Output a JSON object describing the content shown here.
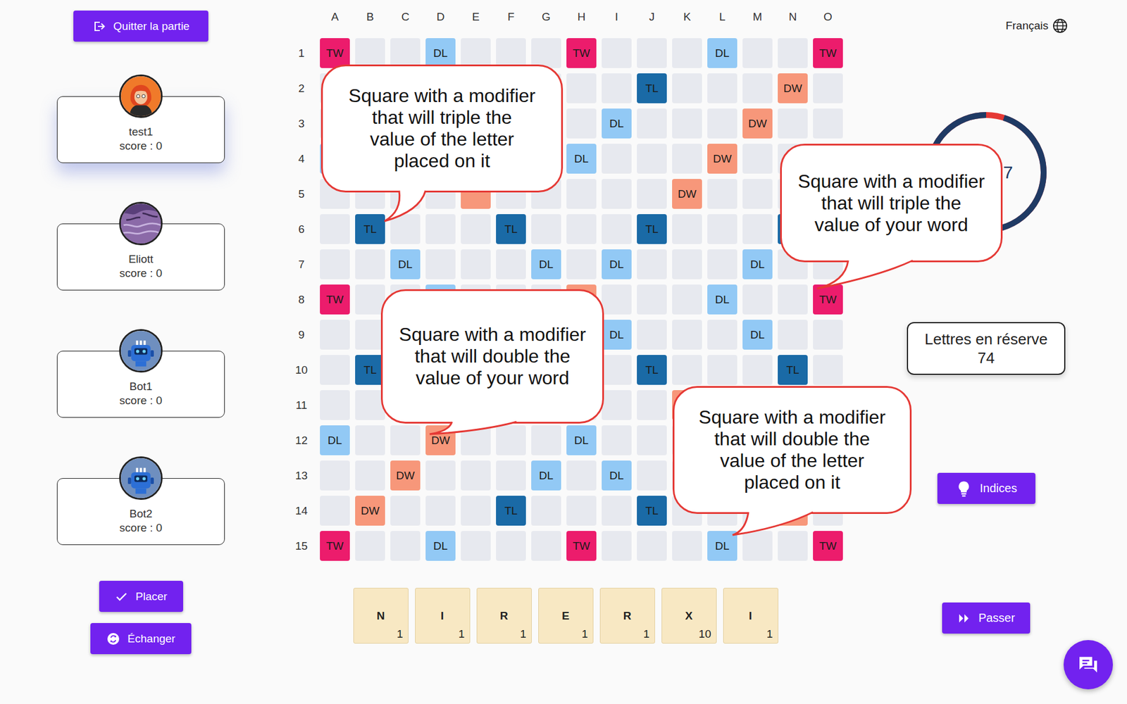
{
  "header": {
    "quit": "Quitter la partie",
    "language": "Français"
  },
  "players": [
    {
      "name": "test1",
      "score": "score : 0",
      "selected": true,
      "kind": "human"
    },
    {
      "name": "Eliott",
      "score": "score : 0",
      "selected": false,
      "kind": "monster"
    },
    {
      "name": "Bot1",
      "score": "score : 0",
      "selected": false,
      "kind": "bot"
    },
    {
      "name": "Bot2",
      "score": "score : 0",
      "selected": false,
      "kind": "bot"
    }
  ],
  "actions": {
    "place": "Placer",
    "exchange": "Échanger",
    "hints": "Indices",
    "pass": "Passer"
  },
  "timer": {
    "text": "7",
    "level": 0.95
  },
  "reserve": {
    "title": "Lettres en réserve",
    "count": "74"
  },
  "board": {
    "columns": [
      "A",
      "B",
      "C",
      "D",
      "E",
      "F",
      "G",
      "H",
      "I",
      "J",
      "K",
      "L",
      "M",
      "N",
      "O"
    ],
    "rows": [
      {
        "label": "1",
        "cells": [
          {
            "mod": "TW",
            "label": "TW"
          },
          {
            "mod": "none"
          },
          {
            "mod": "none"
          },
          {
            "mod": "DL",
            "label": "DL"
          },
          {
            "mod": "none"
          },
          {
            "mod": "none"
          },
          {
            "mod": "none"
          },
          {
            "mod": "TW",
            "label": "TW"
          },
          {
            "mod": "none"
          },
          {
            "mod": "none"
          },
          {
            "mod": "none"
          },
          {
            "mod": "DL",
            "label": "DL"
          },
          {
            "mod": "none"
          },
          {
            "mod": "none"
          },
          {
            "mod": "TW",
            "label": "TW"
          }
        ]
      },
      {
        "label": "2",
        "cells": [
          {
            "mod": "none"
          },
          {
            "mod": "DW"
          },
          {
            "mod": "none"
          },
          {
            "mod": "none"
          },
          {
            "mod": "none"
          },
          {
            "mod": "TL"
          },
          {
            "mod": "none"
          },
          {
            "mod": "none"
          },
          {
            "mod": "none"
          },
          {
            "mod": "TL",
            "label": "TL"
          },
          {
            "mod": "none"
          },
          {
            "mod": "none"
          },
          {
            "mod": "none"
          },
          {
            "mod": "DW",
            "label": "DW"
          },
          {
            "mod": "none"
          }
        ]
      },
      {
        "label": "3",
        "cells": [
          {
            "mod": "none"
          },
          {
            "mod": "none"
          },
          {
            "mod": "DW"
          },
          {
            "mod": "none"
          },
          {
            "mod": "none"
          },
          {
            "mod": "none"
          },
          {
            "mod": "DL"
          },
          {
            "mod": "none"
          },
          {
            "mod": "DL",
            "label": "DL"
          },
          {
            "mod": "none"
          },
          {
            "mod": "none"
          },
          {
            "mod": "none"
          },
          {
            "mod": "DW",
            "label": "DW"
          },
          {
            "mod": "none"
          },
          {
            "mod": "none"
          }
        ]
      },
      {
        "label": "4",
        "cells": [
          {
            "mod": "DL"
          },
          {
            "mod": "none"
          },
          {
            "mod": "none"
          },
          {
            "mod": "DW"
          },
          {
            "mod": "none"
          },
          {
            "mod": "none"
          },
          {
            "mod": "none"
          },
          {
            "mod": "DL",
            "label": "DL"
          },
          {
            "mod": "none"
          },
          {
            "mod": "none"
          },
          {
            "mod": "none"
          },
          {
            "mod": "DW",
            "label": "DW"
          },
          {
            "mod": "none"
          },
          {
            "mod": "none"
          },
          {
            "mod": "DL"
          }
        ]
      },
      {
        "label": "5",
        "cells": [
          {
            "mod": "none"
          },
          {
            "mod": "none"
          },
          {
            "mod": "none"
          },
          {
            "mod": "none"
          },
          {
            "mod": "DW"
          },
          {
            "mod": "none"
          },
          {
            "mod": "none"
          },
          {
            "mod": "none"
          },
          {
            "mod": "none"
          },
          {
            "mod": "none"
          },
          {
            "mod": "DW",
            "label": "DW"
          },
          {
            "mod": "none"
          },
          {
            "mod": "none"
          },
          {
            "mod": "none"
          },
          {
            "mod": "none"
          }
        ]
      },
      {
        "label": "6",
        "cells": [
          {
            "mod": "none"
          },
          {
            "mod": "TL",
            "label": "TL"
          },
          {
            "mod": "none"
          },
          {
            "mod": "none"
          },
          {
            "mod": "none"
          },
          {
            "mod": "TL",
            "label": "TL"
          },
          {
            "mod": "none"
          },
          {
            "mod": "none"
          },
          {
            "mod": "none"
          },
          {
            "mod": "TL",
            "label": "TL"
          },
          {
            "mod": "none"
          },
          {
            "mod": "none"
          },
          {
            "mod": "none"
          },
          {
            "mod": "TL"
          },
          {
            "mod": "none"
          }
        ]
      },
      {
        "label": "7",
        "cells": [
          {
            "mod": "none"
          },
          {
            "mod": "none"
          },
          {
            "mod": "DL",
            "label": "DL"
          },
          {
            "mod": "none"
          },
          {
            "mod": "none"
          },
          {
            "mod": "none"
          },
          {
            "mod": "DL",
            "label": "DL"
          },
          {
            "mod": "none"
          },
          {
            "mod": "DL",
            "label": "DL"
          },
          {
            "mod": "none"
          },
          {
            "mod": "none"
          },
          {
            "mod": "none"
          },
          {
            "mod": "DL",
            "label": "DL"
          },
          {
            "mod": "none"
          },
          {
            "mod": "none"
          }
        ]
      },
      {
        "label": "8",
        "cells": [
          {
            "mod": "TW",
            "label": "TW"
          },
          {
            "mod": "none"
          },
          {
            "mod": "none"
          },
          {
            "mod": "DL"
          },
          {
            "mod": "none"
          },
          {
            "mod": "none"
          },
          {
            "mod": "none"
          },
          {
            "mod": "DW"
          },
          {
            "mod": "none"
          },
          {
            "mod": "none"
          },
          {
            "mod": "none"
          },
          {
            "mod": "DL",
            "label": "DL"
          },
          {
            "mod": "none"
          },
          {
            "mod": "none"
          },
          {
            "mod": "TW",
            "label": "TW"
          }
        ]
      },
      {
        "label": "9",
        "cells": [
          {
            "mod": "none"
          },
          {
            "mod": "none"
          },
          {
            "mod": "DL"
          },
          {
            "mod": "none"
          },
          {
            "mod": "none"
          },
          {
            "mod": "none"
          },
          {
            "mod": "DL"
          },
          {
            "mod": "none"
          },
          {
            "mod": "DL",
            "label": "DL"
          },
          {
            "mod": "none"
          },
          {
            "mod": "none"
          },
          {
            "mod": "none"
          },
          {
            "mod": "DL",
            "label": "DL"
          },
          {
            "mod": "none"
          },
          {
            "mod": "none"
          }
        ]
      },
      {
        "label": "10",
        "cells": [
          {
            "mod": "none"
          },
          {
            "mod": "TL",
            "label": "TL"
          },
          {
            "mod": "none"
          },
          {
            "mod": "none"
          },
          {
            "mod": "none"
          },
          {
            "mod": "TL"
          },
          {
            "mod": "none"
          },
          {
            "mod": "none"
          },
          {
            "mod": "none"
          },
          {
            "mod": "TL",
            "label": "TL"
          },
          {
            "mod": "none"
          },
          {
            "mod": "none"
          },
          {
            "mod": "none"
          },
          {
            "mod": "TL",
            "label": "TL"
          },
          {
            "mod": "none"
          }
        ]
      },
      {
        "label": "11",
        "cells": [
          {
            "mod": "none"
          },
          {
            "mod": "none"
          },
          {
            "mod": "none"
          },
          {
            "mod": "none"
          },
          {
            "mod": "DW"
          },
          {
            "mod": "none"
          },
          {
            "mod": "none"
          },
          {
            "mod": "none"
          },
          {
            "mod": "none"
          },
          {
            "mod": "none"
          },
          {
            "mod": "DW"
          },
          {
            "mod": "none"
          },
          {
            "mod": "none"
          },
          {
            "mod": "none"
          },
          {
            "mod": "none"
          }
        ]
      },
      {
        "label": "12",
        "cells": [
          {
            "mod": "DL",
            "label": "DL"
          },
          {
            "mod": "none"
          },
          {
            "mod": "none"
          },
          {
            "mod": "DW",
            "label": "DW"
          },
          {
            "mod": "none"
          },
          {
            "mod": "none"
          },
          {
            "mod": "none"
          },
          {
            "mod": "DL",
            "label": "DL"
          },
          {
            "mod": "none"
          },
          {
            "mod": "none"
          },
          {
            "mod": "none"
          },
          {
            "mod": "DW"
          },
          {
            "mod": "none"
          },
          {
            "mod": "none"
          },
          {
            "mod": "DL"
          }
        ]
      },
      {
        "label": "13",
        "cells": [
          {
            "mod": "none"
          },
          {
            "mod": "none"
          },
          {
            "mod": "DW",
            "label": "DW"
          },
          {
            "mod": "none"
          },
          {
            "mod": "none"
          },
          {
            "mod": "none"
          },
          {
            "mod": "DL",
            "label": "DL"
          },
          {
            "mod": "none"
          },
          {
            "mod": "DL",
            "label": "DL"
          },
          {
            "mod": "none"
          },
          {
            "mod": "none"
          },
          {
            "mod": "none"
          },
          {
            "mod": "DW"
          },
          {
            "mod": "none"
          },
          {
            "mod": "none"
          }
        ]
      },
      {
        "label": "14",
        "cells": [
          {
            "mod": "none"
          },
          {
            "mod": "DW",
            "label": "DW"
          },
          {
            "mod": "none"
          },
          {
            "mod": "none"
          },
          {
            "mod": "none"
          },
          {
            "mod": "TL",
            "label": "TL"
          },
          {
            "mod": "none"
          },
          {
            "mod": "none"
          },
          {
            "mod": "none"
          },
          {
            "mod": "TL",
            "label": "TL"
          },
          {
            "mod": "none"
          },
          {
            "mod": "none"
          },
          {
            "mod": "none"
          },
          {
            "mod": "DW"
          },
          {
            "mod": "none"
          }
        ]
      },
      {
        "label": "15",
        "cells": [
          {
            "mod": "TW",
            "label": "TW"
          },
          {
            "mod": "none"
          },
          {
            "mod": "none"
          },
          {
            "mod": "DL",
            "label": "DL"
          },
          {
            "mod": "none"
          },
          {
            "mod": "none"
          },
          {
            "mod": "none"
          },
          {
            "mod": "TW",
            "label": "TW"
          },
          {
            "mod": "none"
          },
          {
            "mod": "none"
          },
          {
            "mod": "none"
          },
          {
            "mod": "DL",
            "label": "DL"
          },
          {
            "mod": "none"
          },
          {
            "mod": "none"
          },
          {
            "mod": "TW",
            "label": "TW"
          }
        ]
      }
    ]
  },
  "rack": [
    {
      "letter": "N",
      "points": "1"
    },
    {
      "letter": "I",
      "points": "1"
    },
    {
      "letter": "R",
      "points": "1"
    },
    {
      "letter": "E",
      "points": "1"
    },
    {
      "letter": "R",
      "points": "1"
    },
    {
      "letter": "X",
      "points": "10"
    },
    {
      "letter": "I",
      "points": "1"
    }
  ],
  "callouts": [
    {
      "lines": [
        "Square with a modifier",
        "that will triple the",
        "value of the letter",
        "placed on it"
      ]
    },
    {
      "lines": [
        "Square with a modifier",
        "that will triple the",
        "value of your word"
      ]
    },
    {
      "lines": [
        "Square with a modifier",
        "that will double the",
        "value of your word"
      ]
    },
    {
      "lines": [
        "Square with a modifier",
        "that will double the",
        "value of the letter",
        "placed on it"
      ]
    }
  ]
}
